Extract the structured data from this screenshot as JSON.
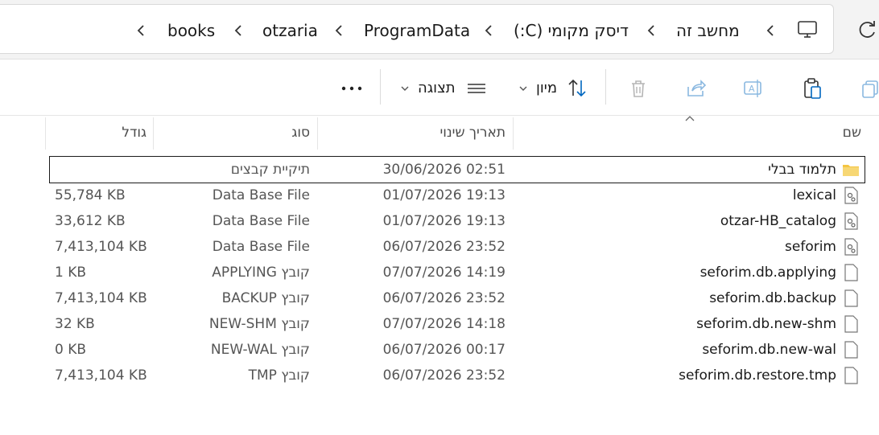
{
  "address_bar": {
    "crumbs": [
      "books",
      "otzaria",
      "ProgramData",
      "דיסק מקומי (C:)",
      "מחשב זה"
    ]
  },
  "command_bar": {
    "view_label": "תצוגה",
    "sort_label": "מיון"
  },
  "columns": {
    "name": "שם",
    "date": "תאריך שינוי",
    "type": "סוג",
    "size": "גודל"
  },
  "files": [
    {
      "name": "תלמוד בבלי",
      "date": "30/06/2026 02:51",
      "type": "תיקיית קבצים",
      "size": "",
      "icon": "folder-icon"
    },
    {
      "name": "lexical",
      "date": "01/07/2026 19:13",
      "type": "Data Base File",
      "size": "55,784 KB",
      "icon": "database-file-icon"
    },
    {
      "name": "otzar-HB_catalog",
      "date": "01/07/2026 19:13",
      "type": "Data Base File",
      "size": "33,612 KB",
      "icon": "database-file-icon"
    },
    {
      "name": "seforim",
      "date": "06/07/2026 23:52",
      "type": "Data Base File",
      "size": "7,413,104 KB",
      "icon": "database-file-icon"
    },
    {
      "name": "seforim.db.applying",
      "date": "07/07/2026 14:19",
      "type": "קובץ APPLYING",
      "size": "1 KB",
      "icon": "file-icon"
    },
    {
      "name": "seforim.db.backup",
      "date": "06/07/2026 23:52",
      "type": "קובץ BACKUP",
      "size": "7,413,104 KB",
      "icon": "file-icon"
    },
    {
      "name": "seforim.db.new-shm",
      "date": "07/07/2026 14:18",
      "type": "קובץ NEW-SHM",
      "size": "32 KB",
      "icon": "file-icon"
    },
    {
      "name": "seforim.db.new-wal",
      "date": "06/07/2026 00:17",
      "type": "קובץ NEW-WAL",
      "size": "0 KB",
      "icon": "file-icon"
    },
    {
      "name": "seforim.db.restore.tmp",
      "date": "06/07/2026 23:52",
      "type": "קובץ TMP",
      "size": "7,413,104 KB",
      "icon": "file-icon"
    }
  ],
  "selected_index": 0,
  "colors": {
    "accent": "#0067c0",
    "folder": "#f4c542",
    "text_muted": "#555555"
  }
}
